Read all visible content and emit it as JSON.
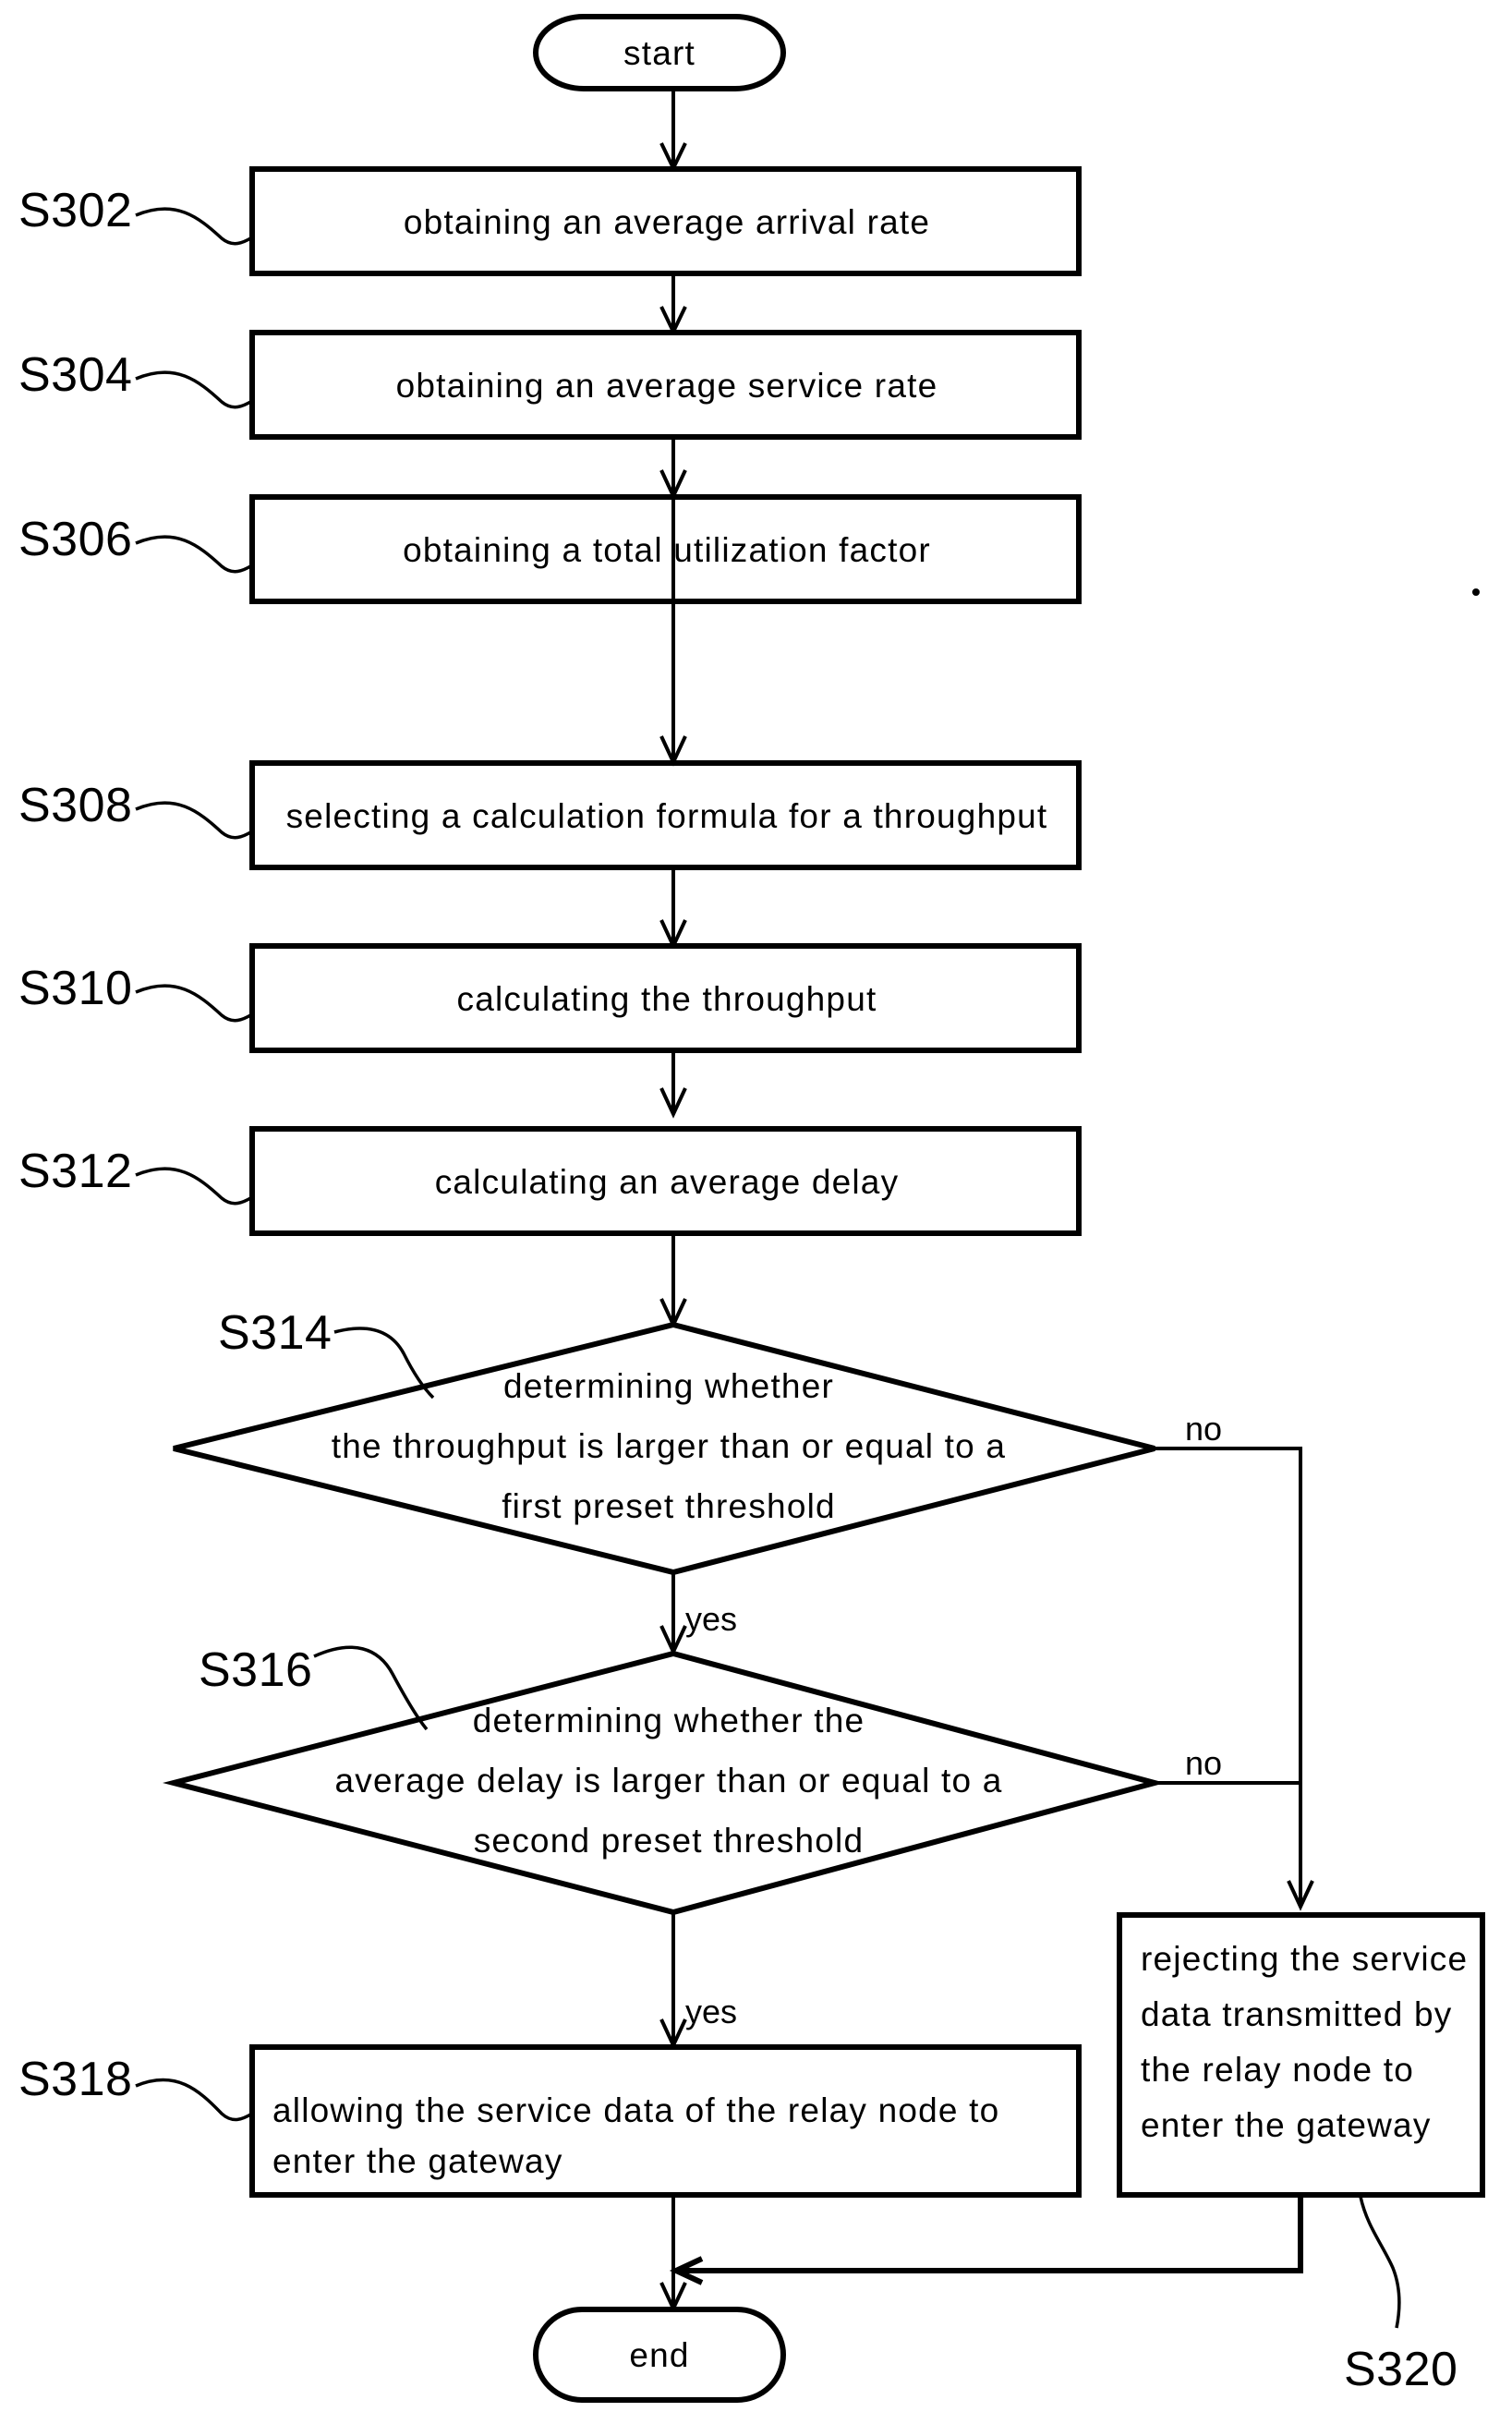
{
  "diagram": {
    "title": "Flowchart of service data admission control method",
    "type": "flowchart",
    "background_color": "#ffffff",
    "line_color": "#000000"
  },
  "terminals": {
    "start": "start",
    "end": "end"
  },
  "steps": [
    {
      "id": "S302",
      "ref": "S302",
      "text": "obtaining an average arrival rate",
      "shape": "process"
    },
    {
      "id": "S304",
      "ref": "S304",
      "text": "obtaining an average service rate",
      "shape": "process"
    },
    {
      "id": "S306",
      "ref": "S306",
      "text": "obtaining a total utilization factor",
      "shape": "process"
    },
    {
      "id": "S308",
      "ref": "S308",
      "text": "selecting a calculation formula for a throughput",
      "shape": "process"
    },
    {
      "id": "S310",
      "ref": "S310",
      "text": "calculating the throughput",
      "shape": "process"
    },
    {
      "id": "S312",
      "ref": "S312",
      "text": "calculating an average delay",
      "shape": "process"
    }
  ],
  "decisions": [
    {
      "id": "S314",
      "ref": "S314",
      "lines": [
        "determining whether",
        "the throughput is larger than or equal to a",
        "first preset threshold"
      ],
      "yes_label": "yes",
      "no_label": "no"
    },
    {
      "id": "S316",
      "ref": "S316",
      "lines": [
        "determining whether the",
        "average delay is larger than or equal to a",
        "second preset threshold"
      ],
      "yes_label": "yes",
      "no_label": "no"
    }
  ],
  "outcomes": [
    {
      "id": "S318",
      "ref": "S318",
      "lines": [
        "allowing the service data of the relay node to",
        "enter the gateway"
      ],
      "shape": "process"
    },
    {
      "id": "S320",
      "ref": "S320",
      "lines": [
        "rejecting the service",
        "data transmitted by",
        "the relay node to",
        "enter the gateway"
      ],
      "shape": "process"
    }
  ],
  "step_refs": {
    "s302": "S302",
    "s304": "S304",
    "s306": "S306",
    "s308": "S308",
    "s310": "S310",
    "s312": "S312",
    "s314": "S314",
    "s316": "S316",
    "s318": "S318",
    "s320": "S320"
  },
  "step_texts": {
    "s302": "obtaining an average arrival rate",
    "s304": "obtaining an average service rate",
    "s306": "obtaining a total utilization factor",
    "s308": "selecting a calculation formula for a throughput",
    "s310": "calculating the throughput",
    "s312": "calculating an average delay",
    "s314_l1": "determining whether",
    "s314_l2": "the throughput is larger than or equal to a",
    "s314_l3": "first preset threshold",
    "s316_l1": "determining whether the",
    "s316_l2": "average delay is larger than or equal to a",
    "s316_l3": "second preset threshold",
    "s318_l1": "allowing the service data of the relay node to",
    "s318_l2": "enter the gateway",
    "s320_l1": "rejecting the service",
    "s320_l2": "data transmitted by",
    "s320_l3": "the relay node to",
    "s320_l4": "enter the gateway"
  },
  "branches": {
    "s314_no": "no",
    "s314_yes": "yes",
    "s316_no": "no",
    "s316_yes": "yes"
  }
}
